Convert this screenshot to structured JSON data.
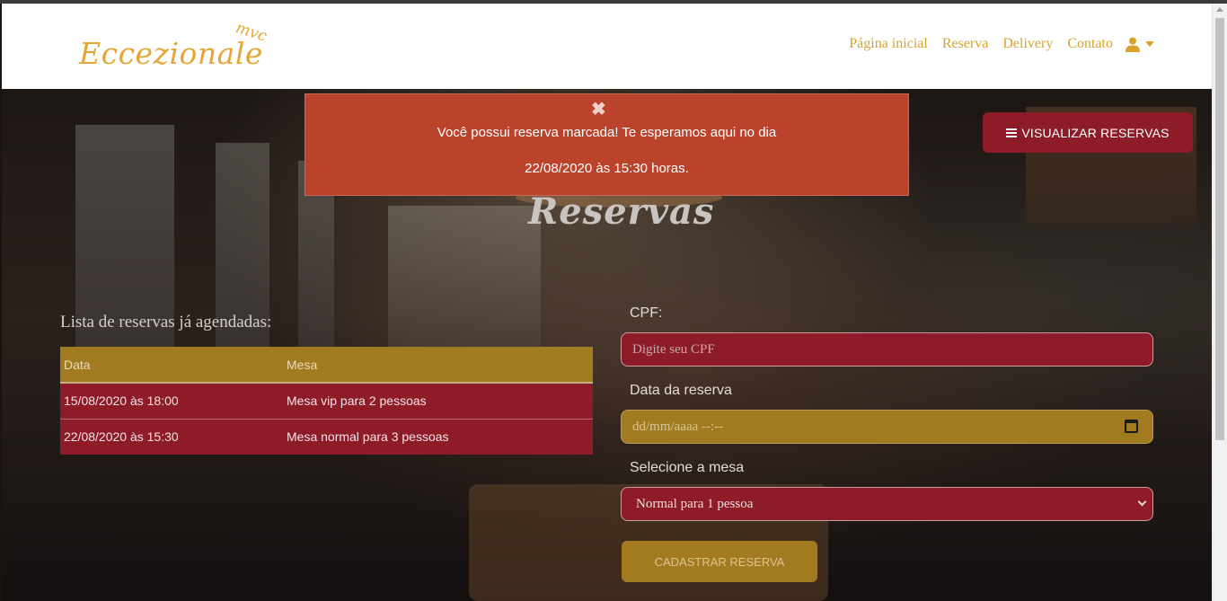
{
  "navbar": {
    "logo_text": "Eccezionale",
    "logo_suffix": "mvc",
    "links": [
      "Página inicial",
      "Reserva",
      "Delivery",
      "Contato"
    ]
  },
  "alert": {
    "close_symbol": "✖",
    "line1": "Você possui reserva marcada! Te esperamos aqui no dia",
    "line2": "22/08/2020 às 15:30 horas."
  },
  "view_button_label": "VISUALIZAR RESERVAS",
  "page_title": "Reservas",
  "reservations": {
    "heading": "Lista de reservas já agendadas:",
    "columns": [
      "Data",
      "Mesa"
    ],
    "rows": [
      {
        "data": "15/08/2020 às 18:00",
        "mesa": "Mesa vip para 2 pessoas"
      },
      {
        "data": "22/08/2020 às 15:30",
        "mesa": "Mesa normal para 3 pessoas"
      }
    ]
  },
  "form": {
    "cpf_label": "CPF:",
    "cpf_placeholder": "Digite seu CPF",
    "date_label": "Data da reserva",
    "date_placeholder": "dd/mm/aaaa  --:--",
    "table_label": "Selecione a mesa",
    "table_selected": "Normal para 1 pessoa",
    "submit_label": "CADASTRAR RESERVA"
  },
  "icons": {
    "user": "user-icon",
    "caret": "caret-down-icon",
    "list": "list-icon",
    "calendar": "calendar-icon",
    "close": "close-icon"
  },
  "colors": {
    "accent_gold": "#d9a22b",
    "maroon": "#8e1b28",
    "alert_red": "#bb432c",
    "mustard": "#a27a1f"
  }
}
